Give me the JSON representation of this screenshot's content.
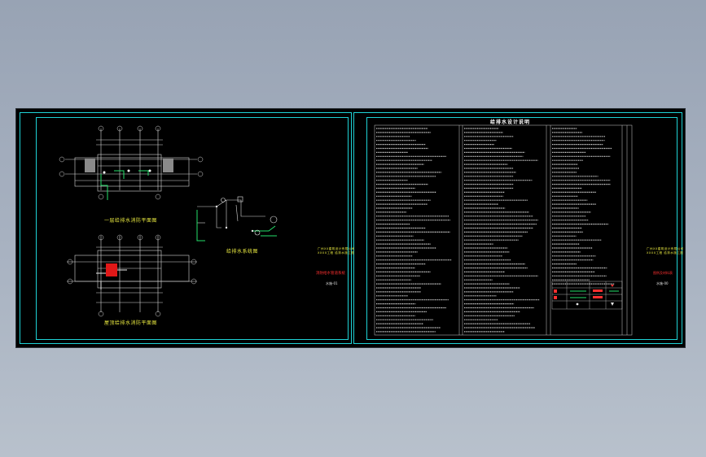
{
  "drawing": {
    "sheet_left": {
      "plan_1_title": "一层给排水消防平面图",
      "plan_2_title": "屋顶给排水消防平面图",
      "system_title": "给排水系统图",
      "stamp_line_1": "广州XX建筑设计有限公司",
      "stamp_line_2": "XXXX工程 给排水施工图",
      "red_label": "消防给水管道系统",
      "sheet_number": "水施-01"
    },
    "sheet_right": {
      "table_title": "给排水设计说明",
      "stamp_line_1": "广州XX建筑设计有限公司",
      "stamp_line_2": "XXXX工程 给排水施工图",
      "red_label": "图例及材料表",
      "sheet_number": "水施-00"
    }
  }
}
